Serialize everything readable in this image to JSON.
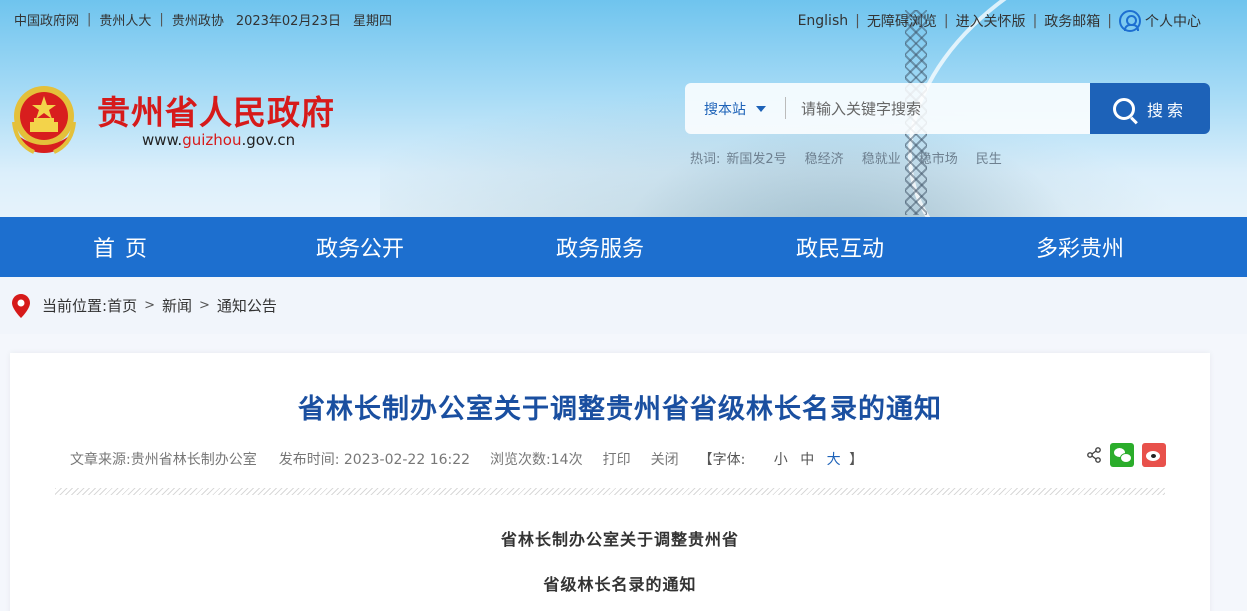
{
  "topbar": {
    "links": [
      "中国政府网",
      "贵州人大",
      "贵州政协"
    ],
    "date": "2023年02月23日",
    "weekday": "星期四"
  },
  "toplinks": {
    "english": "English",
    "accessibility": "无障碍浏览",
    "care": "进入关怀版",
    "mail": "政务邮箱",
    "user": "个人中心"
  },
  "site": {
    "title": "贵州省人民政府",
    "url_prefix": "www.",
    "url_highlight": "guizhou",
    "url_suffix": ".gov.cn"
  },
  "search": {
    "scope": "搜本站",
    "placeholder": "请输入关键字搜索",
    "button": "搜索"
  },
  "hot": {
    "label": "热词:",
    "words": [
      "新国发2号",
      "稳经济",
      "稳就业",
      "稳市场",
      "民生"
    ]
  },
  "nav": [
    "首页",
    "政务公开",
    "政务服务",
    "政民互动",
    "多彩贵州"
  ],
  "breadcrumb": {
    "label": "当前位置:",
    "items": [
      "首页",
      "新闻",
      "通知公告"
    ]
  },
  "article": {
    "title": "省林长制办公室关于调整贵州省省级林长名录的通知",
    "source": "文章来源:贵州省林长制办公室",
    "publish": "发布时间: 2023-02-22 16:22",
    "views": "浏览次数:14次",
    "print": "打印",
    "close": "关闭",
    "font_open": "【字体:",
    "font_small": "小",
    "font_mid": "中",
    "font_large": "大",
    "font_close": "】",
    "body_title_line1": "省林长制办公室关于调整贵州省",
    "body_title_line2": "省级林长名录的通知"
  },
  "colors": {
    "brand_red": "#d61a1a",
    "nav_blue": "#1d6fcf",
    "title_blue": "#1a4fa0"
  }
}
